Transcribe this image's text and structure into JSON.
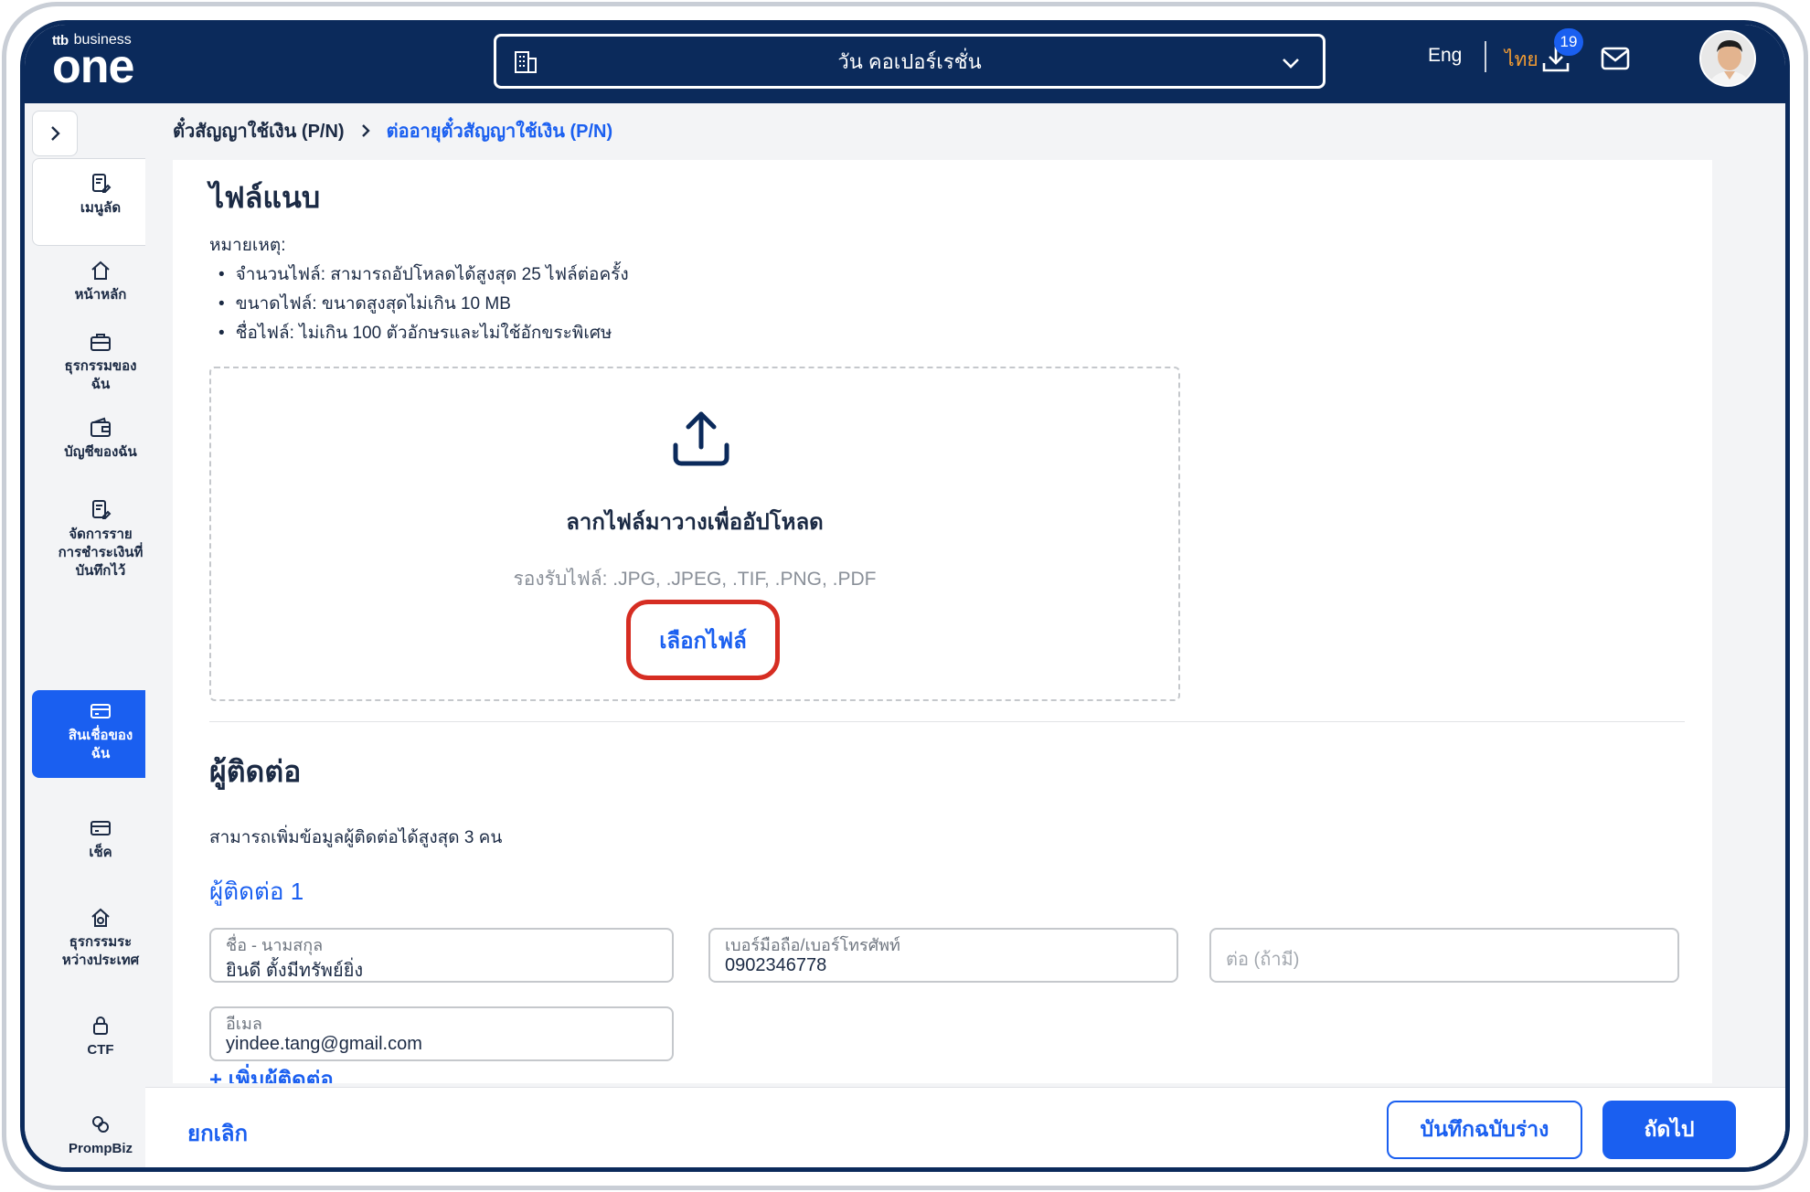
{
  "header": {
    "logo_small": "business",
    "logo_brand": "ttb",
    "logo_main": "one",
    "company": "วัน คอเปอร์เรชั่น",
    "lang_en": "Eng",
    "lang_th": "ไทย",
    "download_badge": "19",
    "icons": {
      "building": "building-icon",
      "chevron": "chevron-down-icon",
      "download": "download-icon",
      "mail": "mail-icon"
    }
  },
  "sidebar": {
    "items": [
      {
        "label": "เมนูลัด"
      },
      {
        "label": "หน้าหลัก"
      },
      {
        "label": "ธุรกรรมของ\nฉัน"
      },
      {
        "label": "บัญชีของฉัน"
      },
      {
        "label": "จัดการราย\nการชำระเงินที่\nบันทึกไว้"
      },
      {
        "label": "สินเชื่อของ\nฉัน"
      },
      {
        "label": "เช็ค"
      },
      {
        "label": "ธุรกรรมระ\nหว่างประเทศ"
      },
      {
        "label": "CTF"
      },
      {
        "label": "PrompBiz"
      }
    ]
  },
  "breadcrumb": {
    "parent": "ตั๋วสัญญาใช้เงิน (P/N)",
    "current": "ต่ออายุตั๋วสัญญาใช้เงิน (P/N)"
  },
  "attachments": {
    "title": "ไฟล์แนบ",
    "note_label": "หมายเหตุ:",
    "notes": [
      "จำนวนไฟล์: สามารถอัปโหลดได้สูงสุด 25 ไฟล์ต่อครั้ง",
      "ขนาดไฟล์: ขนาดสูงสุดไม่เกิน 10 MB",
      "ชื่อไฟล์: ไม่เกิน 100 ตัวอักษรและไม่ใช้อักขระพิเศษ"
    ],
    "drop_title": "ลากไฟล์มาวางเพื่ออัปโหลด",
    "drop_formats": "รองรับไฟล์: .JPG, .JPEG, .TIF, .PNG, .PDF",
    "choose_button": "เลือกไฟล์"
  },
  "contacts": {
    "title": "ผู้ติดต่อ",
    "subtitle": "สามารถเพิ่มข้อมูลผู้ติดต่อได้สูงสุด 3 คน",
    "contact_heading": "ผู้ติดต่อ 1",
    "name_label": "ชื่อ - นามสกุล",
    "name_value": "ยินดี ตั้งมีทรัพย์ยิ่ง",
    "phone_label": "เบอร์มือถือ/เบอร์โทรศัพท์",
    "phone_value": "0902346778",
    "ext_placeholder": "ต่อ (ถ้ามี)",
    "email_label": "อีเมล",
    "email_value": "yindee.tang@gmail.com",
    "add_contact": "+ เพิ่มผู้ติดต่อ"
  },
  "footer": {
    "cancel": "ยกเลิก",
    "save_draft": "บันทึกฉบับร่าง",
    "next": "ถัดไป"
  },
  "colors": {
    "navy": "#0b2a5b",
    "primary": "#1a5ff0",
    "orange": "#f39c32",
    "highlight": "#d62d22"
  }
}
